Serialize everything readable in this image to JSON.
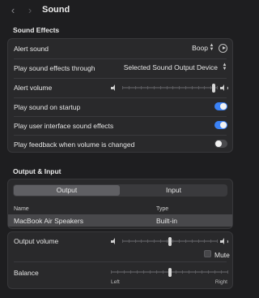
{
  "window": {
    "title": "Sound",
    "back_glyph": "‹",
    "forward_glyph": "›"
  },
  "sound_effects": {
    "heading": "Sound Effects",
    "alert_sound": {
      "label": "Alert sound",
      "value": "Boop"
    },
    "play_through": {
      "label": "Play sound effects through",
      "value": "Selected Sound Output Device"
    },
    "alert_volume": {
      "label": "Alert volume",
      "level": 0.96
    },
    "startup": {
      "label": "Play sound on startup",
      "on": true
    },
    "ui_sounds": {
      "label": "Play user interface sound effects",
      "on": true
    },
    "feedback": {
      "label": "Play feedback when volume is changed",
      "on": false
    }
  },
  "output_input": {
    "heading": "Output & Input",
    "tabs": [
      "Output",
      "Input"
    ],
    "active_tab": "Output",
    "columns": {
      "name": "Name",
      "type": "Type"
    },
    "devices": [
      {
        "name": "MacBook Air Speakers",
        "type": "Built-in",
        "selected": true
      }
    ]
  },
  "output": {
    "volume": {
      "label": "Output volume",
      "level": 0.5
    },
    "mute": {
      "label": "Mute",
      "checked": false
    },
    "balance": {
      "label": "Balance",
      "left_label": "Left",
      "right_label": "Right",
      "level": 0.5
    }
  },
  "colors": {
    "accent": "#3b82f6",
    "background": "#1e1e20",
    "card": "#29292b"
  },
  "icons": {
    "updown": "updown-chevrons-icon",
    "play": "play-circle-icon",
    "speaker_low": "speaker-low-icon",
    "speaker_high": "speaker-high-icon"
  }
}
